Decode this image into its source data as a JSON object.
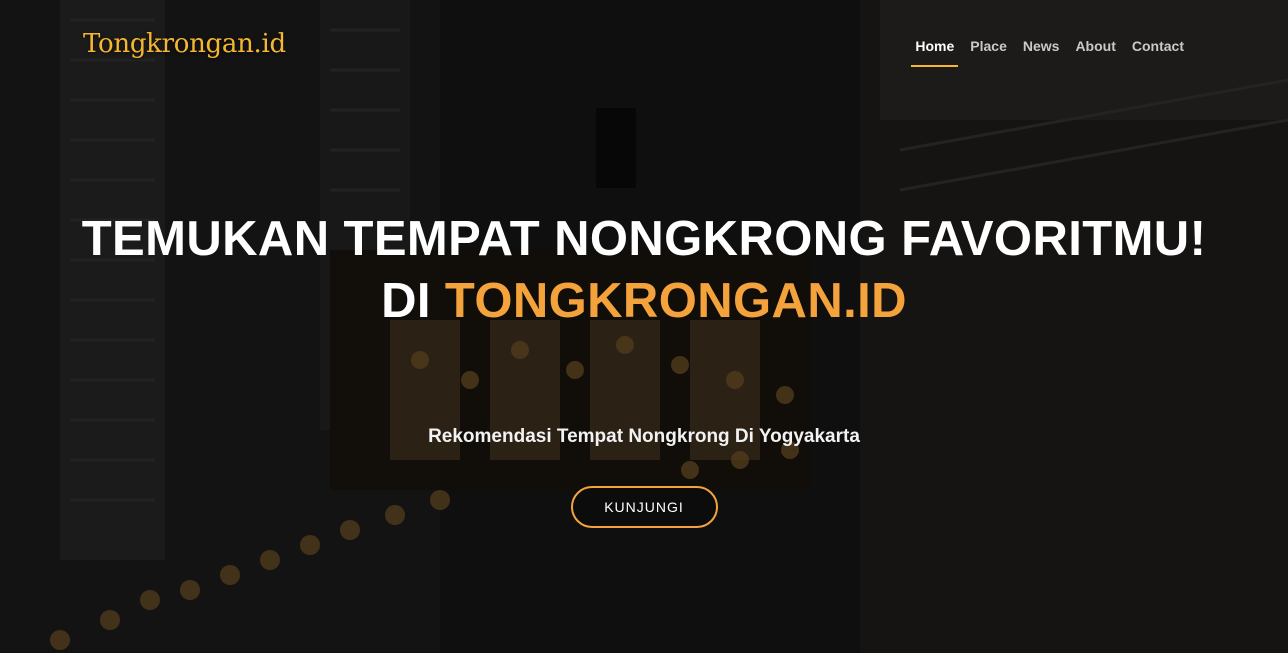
{
  "brand": {
    "name": "Tongkrongan.id"
  },
  "nav": {
    "items": [
      {
        "label": "Home",
        "active": true
      },
      {
        "label": "Place",
        "active": false
      },
      {
        "label": "News",
        "active": false
      },
      {
        "label": "About",
        "active": false
      },
      {
        "label": "Contact",
        "active": false
      }
    ]
  },
  "hero": {
    "headline_line1": "TEMUKAN TEMPAT NONGKRONG FAVORITMU!",
    "headline_line2_prefix": "DI ",
    "headline_line2_accent": "TONGKRONGAN.ID",
    "subtitle": "Rekomendasi Tempat Nongkrong Di Yogyakarta",
    "cta_label": "KUNJUNGI"
  },
  "colors": {
    "accent": "#f4a23c",
    "brand": "#f5b731",
    "background": "#121212"
  }
}
